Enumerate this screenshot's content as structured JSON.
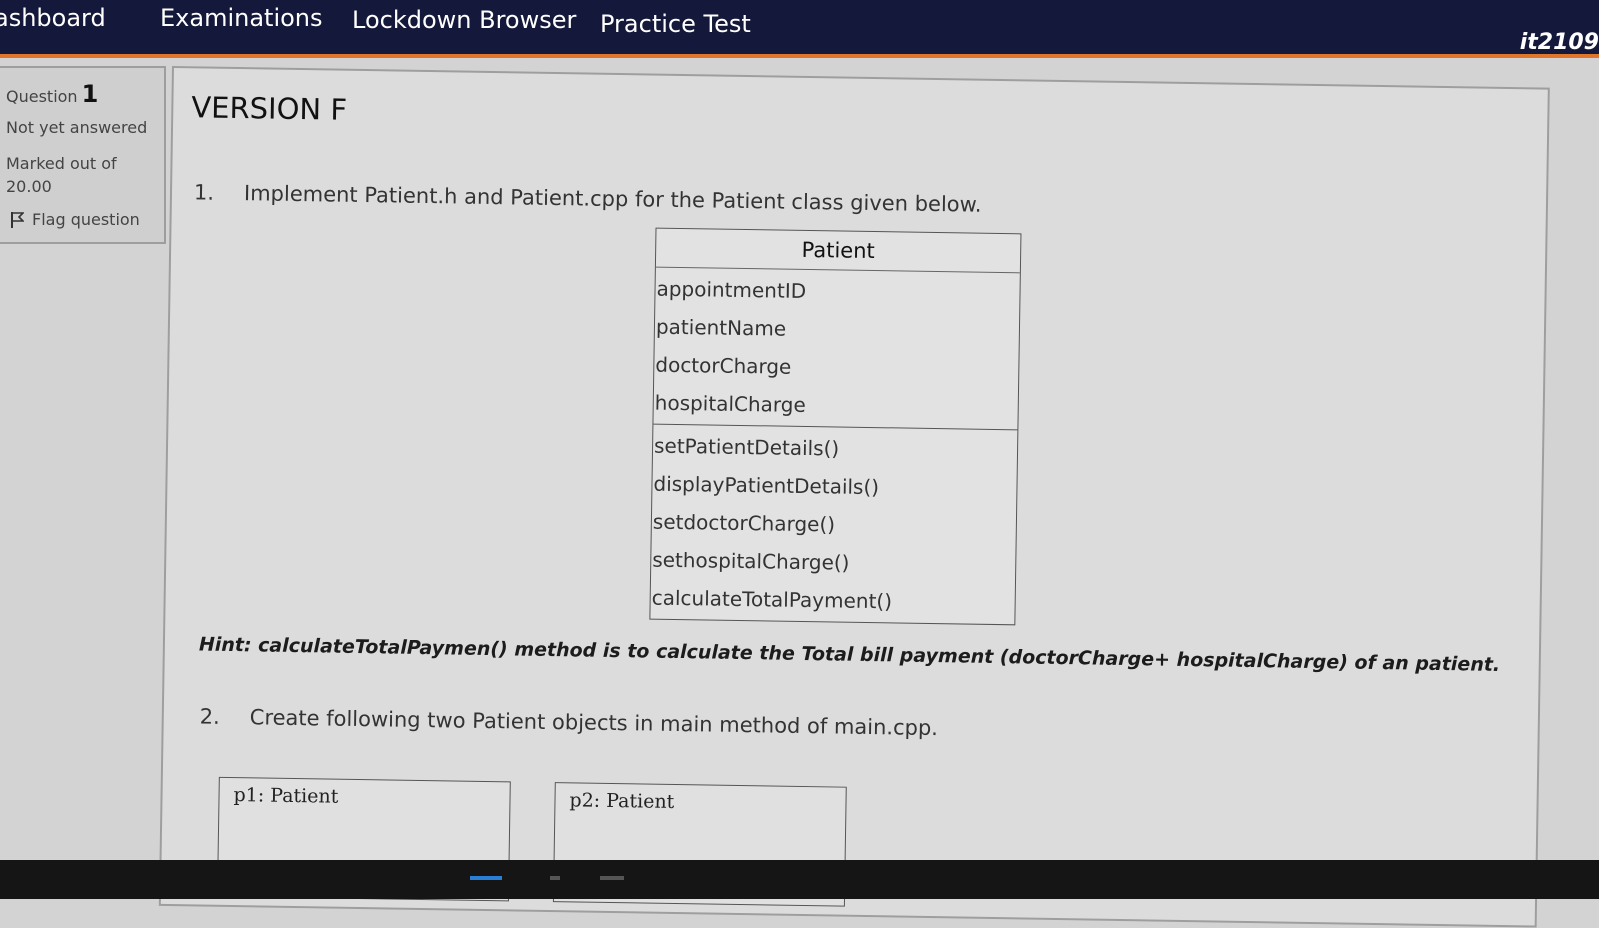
{
  "nav": {
    "items": [
      "ashboard",
      "Examinations",
      "Lockdown Browser",
      "Practice Test"
    ],
    "user": "it2109"
  },
  "question_info": {
    "label": "Question",
    "number": "1",
    "state": "Not yet answered",
    "marked_line1": "Marked out of",
    "marked_line2": "20.00",
    "flag_label": "Flag question",
    "flag_icon": "flag-icon"
  },
  "content": {
    "version": "VERSION F",
    "item1_num": "1.",
    "item1_text": "Implement Patient.h and Patient.cpp for the Patient class given below.",
    "uml": {
      "class_name": "Patient",
      "attributes": [
        "appointmentID",
        "patientName",
        "doctorCharge",
        "hospitalCharge"
      ],
      "methods": [
        "setPatientDetails()",
        "displayPatientDetails()",
        "setdoctorCharge()",
        "sethospitalCharge()",
        "calculateTotalPayment()"
      ]
    },
    "hint": "Hint:  calculateTotalPaymen() method is to calculate the Total bill payment (doctorCharge+ hospitalCharge) of an patient.",
    "item2_num": "2.",
    "item2_text": "Create following two Patient objects in main method of main.cpp.",
    "objects": [
      "p1: Patient",
      "p2: Patient"
    ]
  },
  "colors": {
    "nav_bg": "#14183a",
    "nav_accent": "#e0762c",
    "page_bg": "#d3d3d3"
  }
}
